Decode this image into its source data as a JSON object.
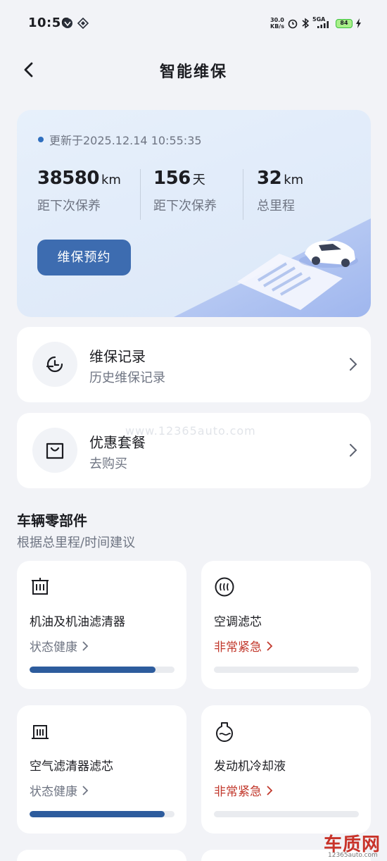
{
  "status_bar": {
    "time": "10:56",
    "net_speed_value": "30.0",
    "net_speed_unit": "KB/s",
    "network": "5GA",
    "battery": "84"
  },
  "header": {
    "title": "智能维保",
    "back_icon": "chevron-left-icon"
  },
  "hero": {
    "update_text": "更新于2025.12.14 10:55:35",
    "stats": [
      {
        "value": "38580",
        "unit": "km",
        "label": "距下次保养"
      },
      {
        "value": "156",
        "unit": "天",
        "label": "距下次保养"
      },
      {
        "value": "32",
        "unit": "km",
        "label": "总里程"
      }
    ],
    "book_button": "维保预约"
  },
  "rows": [
    {
      "title": "维保记录",
      "subtitle": "历史维保记录",
      "icon": "clock-history-icon"
    },
    {
      "title": "优惠套餐",
      "subtitle": "去购买",
      "icon": "shopping-bag-icon"
    }
  ],
  "parts_section": {
    "title": "车辆零部件",
    "subtitle": "根据总里程/时间建议"
  },
  "parts": [
    {
      "name": "机油及机油滤清器",
      "status": "状态健康",
      "level": "ok",
      "progress": 0.87,
      "icon": "oil-filter-icon"
    },
    {
      "name": "空调滤芯",
      "status": "非常紧急",
      "level": "urgent",
      "progress": 0,
      "icon": "ac-filter-icon"
    },
    {
      "name": "空气滤清器滤芯",
      "status": "状态健康",
      "level": "ok",
      "progress": 0.93,
      "icon": "air-filter-icon"
    },
    {
      "name": "发动机冷却液",
      "status": "非常紧急",
      "level": "urgent",
      "progress": 0,
      "icon": "coolant-icon"
    }
  ],
  "watermark": {
    "brand": "车质网",
    "domain": "12365auto.com",
    "url_overlay": "www.12365auto.com"
  },
  "colors": {
    "accent": "#3d6cb0",
    "progress": "#2d5c9d",
    "urgent": "#c2392d",
    "background": "#f2f3f7"
  }
}
